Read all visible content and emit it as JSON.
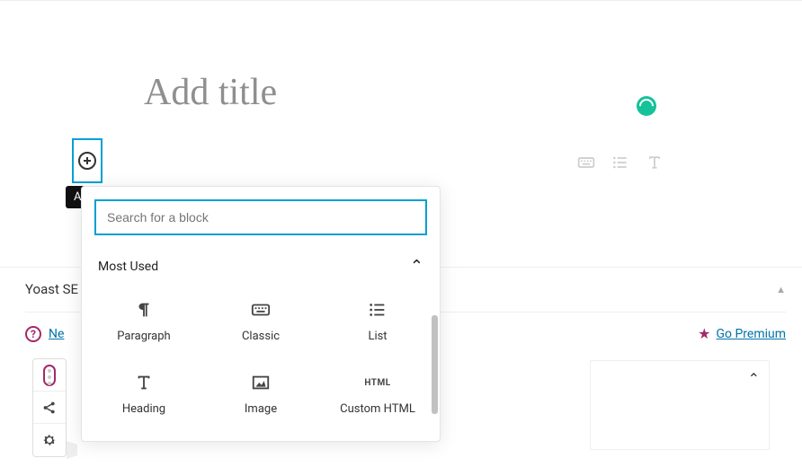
{
  "title_placeholder": "Add title",
  "tooltip": "Add block",
  "search_placeholder": "Search for a block",
  "section_label": "Most Used",
  "blocks": {
    "paragraph": "Paragraph",
    "classic": "Classic",
    "list": "List",
    "heading": "Heading",
    "image": "Image",
    "custom_html": "Custom HTML",
    "html_badge": "HTML"
  },
  "yoast": {
    "panel_title_prefix": "Yoast SE",
    "need_help_prefix": "Ne",
    "go_premium": "Go Premium"
  }
}
